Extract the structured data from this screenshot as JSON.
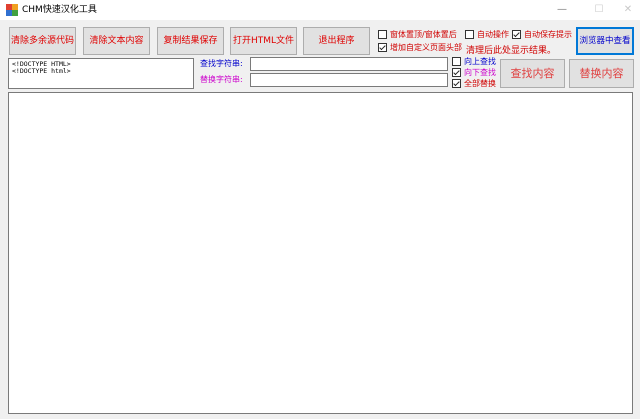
{
  "window": {
    "title": "CHM快速汉化工具",
    "minimize": "—",
    "maximize": "☐",
    "close": "✕"
  },
  "toolbar": {
    "clear_extra_code": "清除多余源代码",
    "clear_text": "清除文本内容",
    "copy_save": "复制结果保存",
    "open_html": "打开HTML文件",
    "exit": "退出程序",
    "browser_view": "浏览器中查看"
  },
  "options": {
    "window_top": {
      "label": "窗体置顶/窗体置后",
      "checked": false
    },
    "add_custom_header": {
      "label": "增加自定义页面头部",
      "checked": true
    },
    "auto_operate": {
      "label": "自动操作",
      "checked": false
    },
    "auto_save_prompt": {
      "label": "自动保存提示",
      "checked": true
    }
  },
  "hint_text": "清理后此处显示结果。",
  "code_preview": [
    "<!DOCTYPE HTML>",
    "<!DOCTYPE html>"
  ],
  "find": {
    "label": "查找字符串:",
    "value": "",
    "search_up": {
      "label": "向上查找",
      "checked": false
    },
    "search_down": {
      "label": "向下查找",
      "checked": true
    },
    "replace_all": {
      "label": "全部替换",
      "checked": true
    },
    "find_button": "查找内容"
  },
  "replace": {
    "label": "替换字符串:",
    "value": "",
    "replace_button": "替换内容"
  },
  "main_text": "",
  "colors": {
    "accent_red": "#e00000",
    "find_label_blue": "#0000cc",
    "replace_label_magenta": "#cc00cc",
    "focus_border": "#0078d7"
  },
  "icons": {
    "app": "chm-app-icon"
  }
}
